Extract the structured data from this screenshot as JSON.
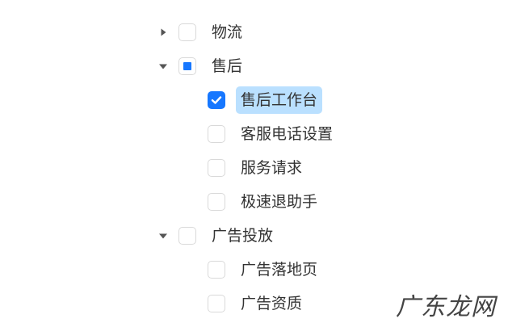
{
  "tree": {
    "nodes": [
      {
        "label": "物流",
        "level": 0,
        "has_children": true,
        "expanded": false,
        "checked": "unchecked",
        "selected": false
      },
      {
        "label": "售后",
        "level": 0,
        "has_children": true,
        "expanded": true,
        "checked": "indeterminate",
        "selected": false
      },
      {
        "label": "售后工作台",
        "level": 1,
        "has_children": false,
        "checked": "checked",
        "selected": true
      },
      {
        "label": "客服电话设置",
        "level": 1,
        "has_children": false,
        "checked": "unchecked",
        "selected": false
      },
      {
        "label": "服务请求",
        "level": 1,
        "has_children": false,
        "checked": "unchecked",
        "selected": false
      },
      {
        "label": "极速退助手",
        "level": 1,
        "has_children": false,
        "checked": "unchecked",
        "selected": false
      },
      {
        "label": "广告投放",
        "level": 0,
        "has_children": true,
        "expanded": true,
        "checked": "unchecked",
        "selected": false
      },
      {
        "label": "广告落地页",
        "level": 1,
        "has_children": false,
        "checked": "unchecked",
        "selected": false
      },
      {
        "label": "广告资质",
        "level": 1,
        "has_children": false,
        "checked": "unchecked",
        "selected": false
      }
    ]
  },
  "icons": {
    "collapsed": "caret-right-icon",
    "expanded": "caret-down-icon",
    "check": "checkmark-icon"
  },
  "colors": {
    "primary": "#1677ff",
    "selected_bg": "#bae0ff",
    "text": "#333333",
    "border": "#d9d9d9",
    "caret": "#555555"
  },
  "watermark": {
    "text": "广东龙网"
  }
}
